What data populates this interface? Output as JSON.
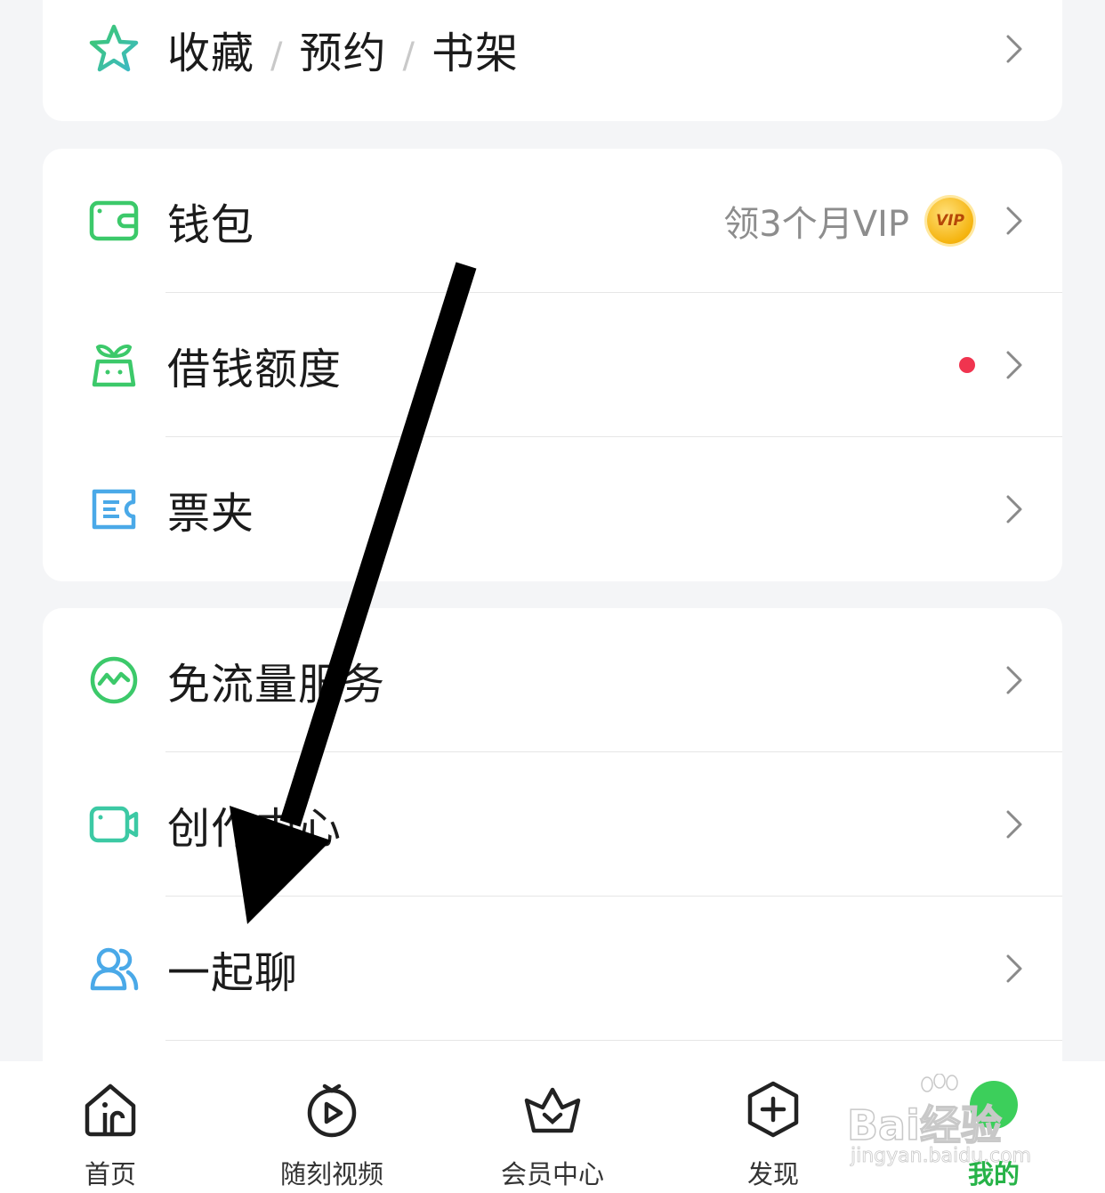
{
  "favorites": {
    "items": [
      "收藏",
      "预约",
      "书架"
    ],
    "separator": "/"
  },
  "wallet_section": {
    "wallet": {
      "label": "钱包",
      "promo": "领3个月VIP",
      "badge": "VIP"
    },
    "loan": {
      "label": "借钱额度"
    },
    "tickets": {
      "label": "票夹"
    }
  },
  "services_section": {
    "free_data": {
      "label": "免流量服务"
    },
    "creator": {
      "label": "创作中心"
    },
    "chat": {
      "label": "一起聊"
    }
  },
  "tabbar": {
    "tabs": [
      {
        "label": "首页"
      },
      {
        "label": "随刻视频"
      },
      {
        "label": "会员中心"
      },
      {
        "label": "发现"
      },
      {
        "label": "我的"
      }
    ]
  },
  "watermark": {
    "brand": "Bai经验",
    "url": "jingyan.baidu.com"
  },
  "colors": {
    "accent_green": "#27b348",
    "icon_green": "#3cc96a",
    "icon_blue": "#4aa9e8",
    "red_dot": "#f0344f",
    "vip_gold": "#f5b40f"
  }
}
